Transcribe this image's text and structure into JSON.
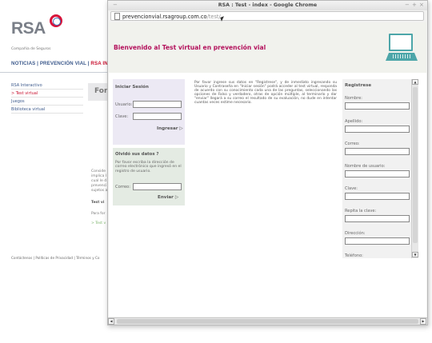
{
  "background_site": {
    "logo_text": "RSA",
    "tagline": "Compañía de Seguros",
    "nav": {
      "left": "NOTICIAS | PREVENCIÓN VIAL | ",
      "right": "RSA IN"
    },
    "sidebar": [
      {
        "label": "RSA Interactivo"
      },
      {
        "label": "> Test virtual"
      },
      {
        "label": "Juegos"
      },
      {
        "label": "Biblioteca virtual"
      }
    ],
    "form_heading": "For",
    "paragraph_lines": [
      "Conside",
      "implica l",
      "cual le d",
      "prevenci",
      "sujetos a"
    ],
    "test_label": "Test vi",
    "para_label": "Para for",
    "test_link": "> Test v",
    "footer": "Contáctenos | Políticas de Privacidad | Términos y Co"
  },
  "window": {
    "title": "RSA : Test - index - Google Chrome",
    "controls": {
      "left": "−",
      "minimize": "−",
      "maximize": "+",
      "close": "×"
    },
    "url": {
      "domain": "prevencionvial.rsagroup.com.co",
      "path": "/test/"
    }
  },
  "banner": {
    "heading": "Bienvenido al Test virtual en prevención vial"
  },
  "login": {
    "heading": "Iniciar Sesión",
    "user_label": "Usuario:",
    "password_label": "Clave:",
    "submit": "Ingresar ▷"
  },
  "forgot": {
    "heading": "Olvidó sus datos ?",
    "text": "Por favor escriba la dirección de correo electrónico que ingresó en el registro de usuario.",
    "email_label": "Correo:",
    "submit": "Enviar ▷"
  },
  "intro": "Por favor ingrese sus datos en \"Registrese\", y de inmediato ingresando su Usuario y Contraseña en \"Iniciar sesión\" podrá acceder al test virtual, responda de acuerdo con su conocimiento cada una de las preguntas, seleccionando las opciones de Falso y verdadero, otras de opción múltiple, al terminarlo y dar \"enviar\" llegará a su correo el resultado de su evaluación, no dude en intentar cuantas veces estime necesario.",
  "register": {
    "heading": "Registrese",
    "fields": [
      {
        "label": "Nombre:"
      },
      {
        "label": "Apellido:"
      },
      {
        "label": "Correo:"
      },
      {
        "label": "Nombre de usuario:"
      },
      {
        "label": "Clave:"
      },
      {
        "label": "Repita la clave:"
      },
      {
        "label": "Dirección:"
      },
      {
        "label": "Teléfono:"
      }
    ]
  }
}
